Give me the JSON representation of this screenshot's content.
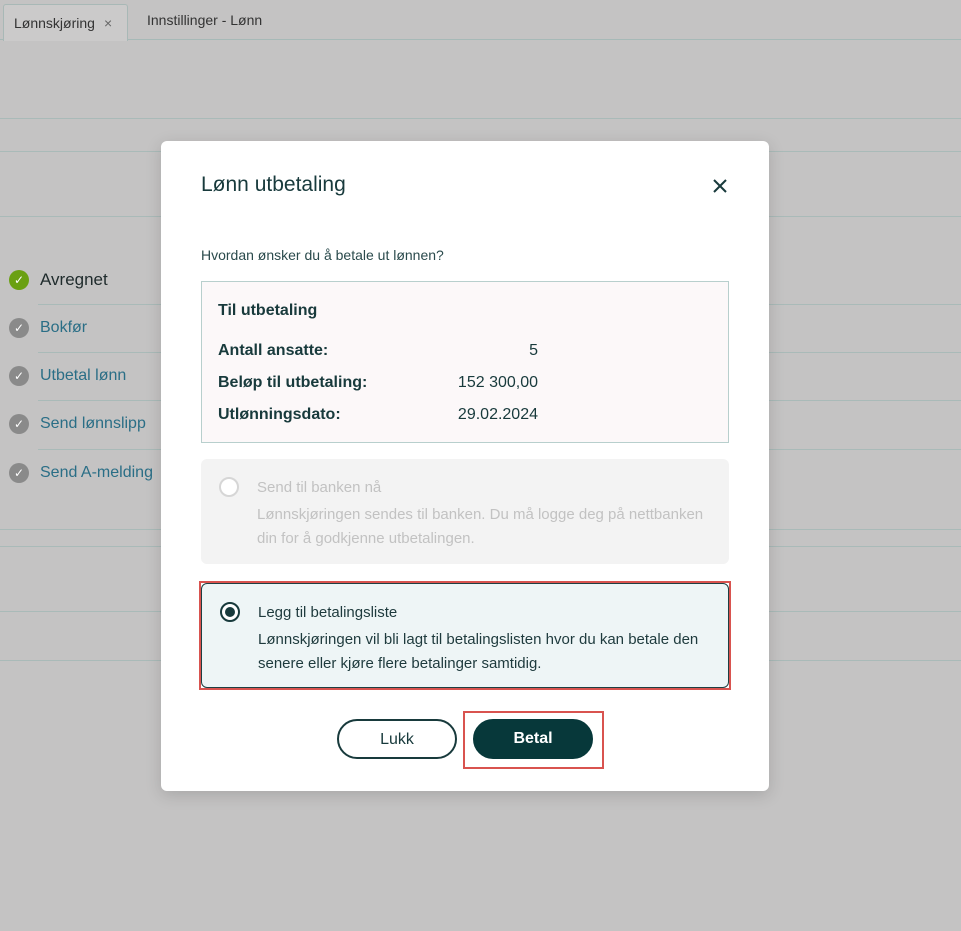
{
  "tabs": [
    {
      "label": "Lønnskjøring",
      "close": "×"
    },
    {
      "label": "Innstillinger - Lønn"
    }
  ],
  "steps": [
    {
      "label": "Avregnet",
      "status": "done"
    },
    {
      "label": "Bokfør",
      "status": "todo"
    },
    {
      "label": "Utbetal lønn",
      "status": "todo"
    },
    {
      "label": "Send lønnslipp",
      "status": "todo"
    },
    {
      "label": "Send A-melding",
      "status": "todo"
    }
  ],
  "modal": {
    "title": "Lønn utbetaling",
    "question": "Hvordan ønsker du å betale ut lønnen?",
    "summary": {
      "title": "Til utbetaling",
      "rows": [
        {
          "key": "Antall ansatte:",
          "value": "5"
        },
        {
          "key": "Beløp til utbetaling:",
          "value": "152 300,00"
        },
        {
          "key": "Utlønningsdato:",
          "value": "29.02.2024"
        }
      ]
    },
    "options": [
      {
        "title": "Send til banken nå",
        "description": "Lønnskjøringen sendes til banken. Du må logge deg på nettbanken din for å godkjenne utbetalingen.",
        "state": "disabled"
      },
      {
        "title": "Legg til betalingsliste",
        "description": "Lønnskjøringen vil bli lagt til betalingslisten hvor du kan betale den senere eller kjøre flere betalinger samtidig.",
        "state": "selected"
      }
    ],
    "buttons": {
      "close": "Lukk",
      "pay": "Betal"
    }
  },
  "colors": {
    "accent": "#07383a",
    "done": "#6aa012",
    "highlight": "#d9534f"
  }
}
